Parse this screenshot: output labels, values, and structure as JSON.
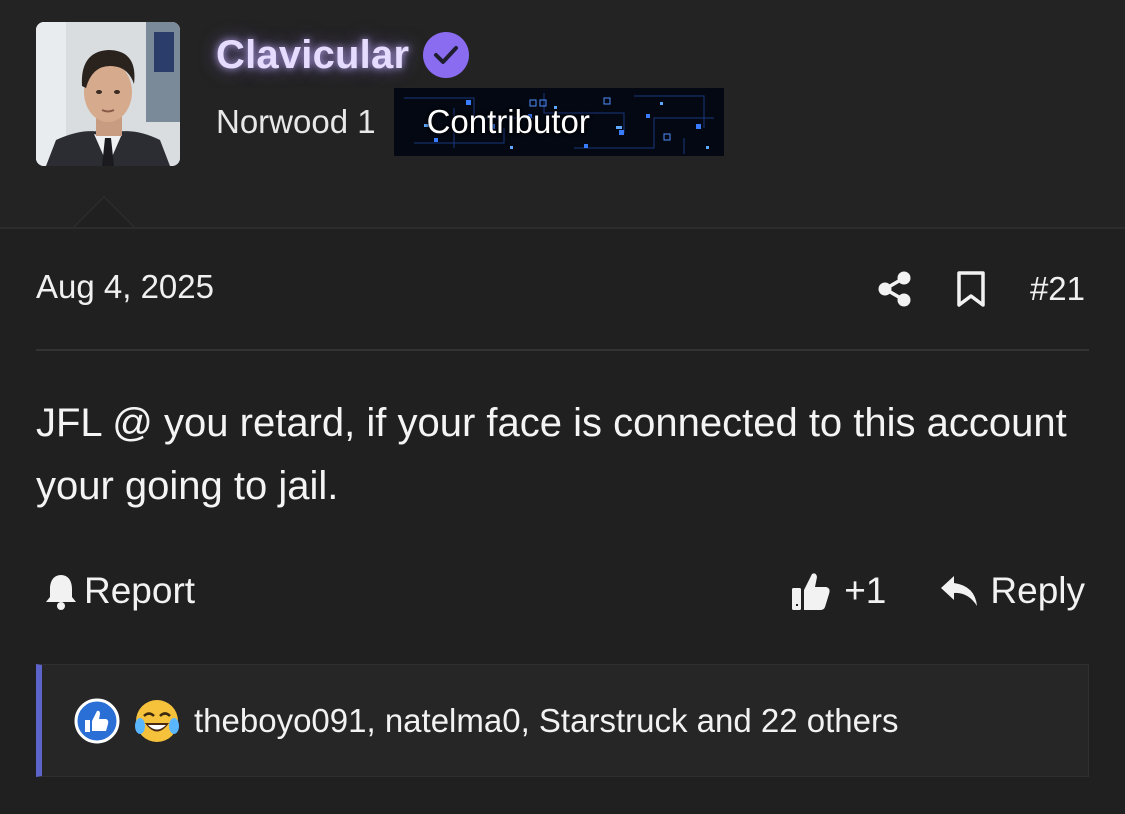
{
  "user": {
    "username": "Clavicular",
    "title": "Norwood 1",
    "rank": "Contributor",
    "verified_icon": "verified-check-icon",
    "colors": {
      "username": "#e6dcff",
      "verified": "#8a6cf0",
      "rank_bg": "#030812"
    }
  },
  "post": {
    "date": "Aug 4, 2025",
    "number": "#21",
    "body": "JFL @ you retard, if your face is connected to this account your going to jail."
  },
  "actions": {
    "share_icon": "share-icon",
    "bookmark_icon": "bookmark-icon",
    "report_label": "Report",
    "like_count": "+1",
    "reply_label": "Reply"
  },
  "reactions": {
    "icons": [
      "like-reaction-icon",
      "laughing-crying-reaction-icon"
    ],
    "text": "theboyo091, natelma0, Starstruck and 22 others",
    "accent": "#5c63c9"
  }
}
